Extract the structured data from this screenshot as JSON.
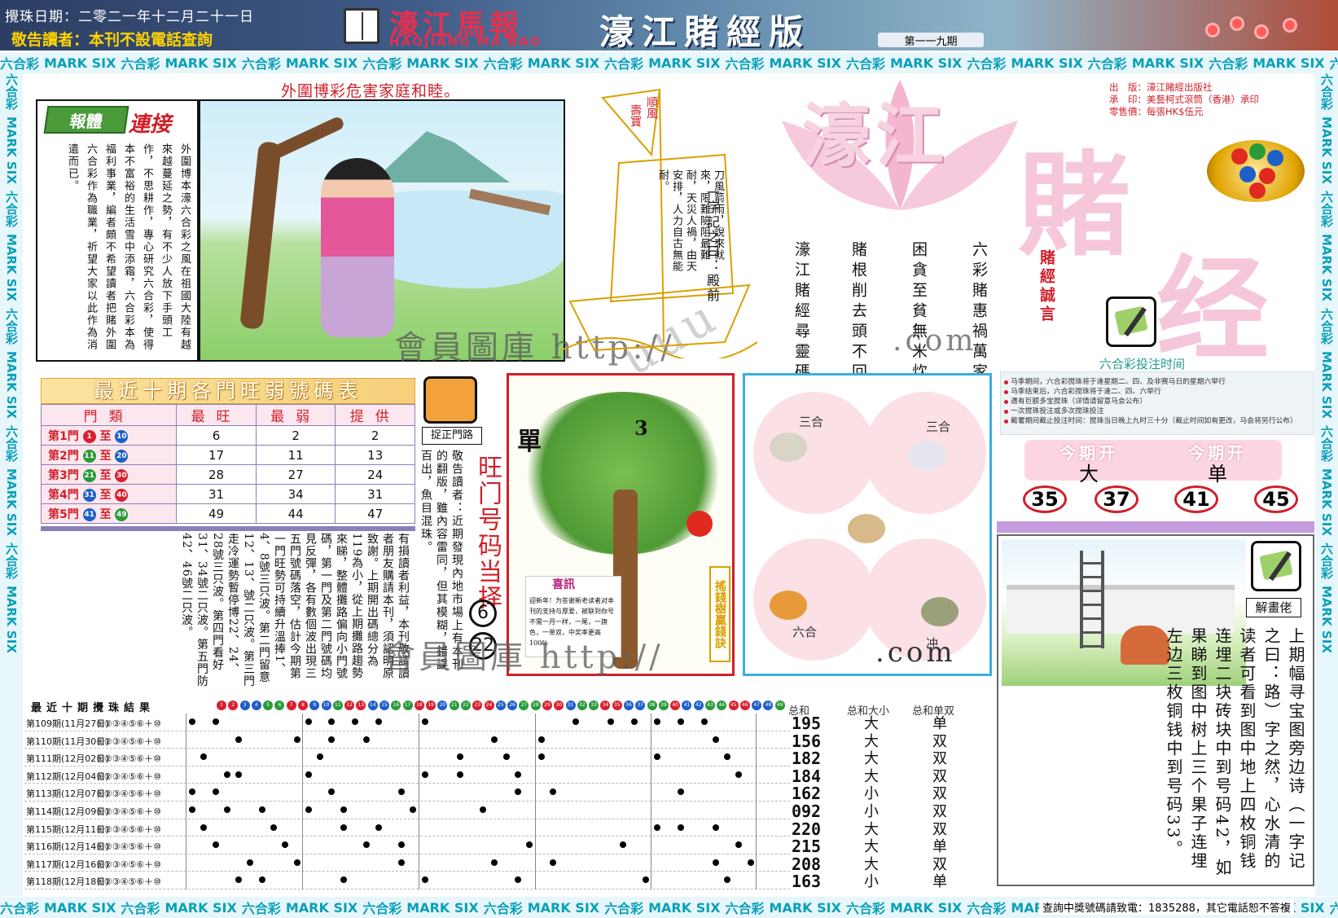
{
  "header": {
    "draw_date": "攪珠日期：二零二一年十二月二十一日",
    "warning": "敬告讀者：本刊不設電話查詢",
    "paper_name": "濠江馬報",
    "paper_name_en": "HAOJIANG MA BAO",
    "edition_title": "濠江賭經版",
    "issue": "第一一九期"
  },
  "band_text": [
    "六合彩",
    "MARK SIX"
  ],
  "slogan": "外圍博彩危害家庭和睦。",
  "article": {
    "badge": "報體",
    "badge_tail": "連接",
    "body": "外圍博本濠六合彩之風在祖國大陸有越來越蔓延之勢，有不少人放下手頭工作，不思耕作，專心研究六合彩，使得本不富裕的生活雪中添霜，六合彩本為福利事業，編者頗不希望讀者把賭外圍六合彩作為職業，祈望大家以此作為消遣而已。"
  },
  "watermarks": {
    "member": "會員圖庫 http://",
    "dotcom": ".com"
  },
  "ship": {
    "flag_line1": "順風",
    "flag_line2": "壽寶",
    "title": "一字記之曰：殿前",
    "poem": "刀風箭雨，說來就來，限難險阻最難耐，天災人禍，由天安排，人力自古無能耐。"
  },
  "big_title": {
    "haojiang": "濠江",
    "du": "賭",
    "jing": "经",
    "publisher": [
      "出　版：濠江賭經出版社",
      "承　印：美藝柯式滾筒（香港）承印",
      "零售價：每張HK$伍元"
    ],
    "motto": "賭經誠言",
    "columns": [
      "六彩賭惠禍萬家",
      "困貪至貧無米炊",
      "賭根削去頭不回",
      "濠江賭經尋靈碼"
    ]
  },
  "time_info": {
    "title": "六合彩投注时间",
    "items": [
      "马季期间，六合彩搅珠将于逢星期二、四、及非赛马日的星期六举行",
      "马季结束后，六合彩搅珠将于逢二、四、六举行",
      "遇有巨额多宝搅珠（详情请留意马会公布）",
      "一次搅珠投注或多次搅珠投注",
      "截署期间截止投注时间：搅珠当日晚上九时三十分（截止时间如有更改，马会将另行公布）"
    ],
    "open_label": "今期开",
    "open_values": [
      "大",
      "单"
    ],
    "numbers": [
      "35",
      "37",
      "41",
      "45"
    ]
  },
  "zone_table": {
    "title": "最近十期各門旺弱號碼表",
    "headers": [
      "門類",
      "最旺",
      "最弱",
      "提供"
    ],
    "rows": [
      {
        "gate": "第1門",
        "from": "1",
        "from_color": "r",
        "to": "10",
        "to_color": "b",
        "hot": "6",
        "cold": "2",
        "tip": "2"
      },
      {
        "gate": "第2門",
        "from": "11",
        "from_color": "g",
        "to": "20",
        "to_color": "b",
        "hot": "17",
        "cold": "11",
        "tip": "13"
      },
      {
        "gate": "第3門",
        "from": "21",
        "from_color": "g",
        "to": "30",
        "to_color": "r",
        "hot": "28",
        "cold": "27",
        "tip": "24"
      },
      {
        "gate": "第4門",
        "from": "31",
        "from_color": "b",
        "to": "40",
        "to_color": "r",
        "hot": "31",
        "cold": "34",
        "tip": "31"
      },
      {
        "gate": "第5門",
        "from": "41",
        "from_color": "b",
        "to": "49",
        "to_color": "g",
        "hot": "49",
        "cold": "44",
        "tip": "47"
      }
    ],
    "to_word": "至"
  },
  "catch_label": "捉正門路",
  "notice": "敬告讀者：近期發現內地市場上有本刊的翻版，雖內容雷同，但其模糊，錯誤百出，魚目混珠。",
  "hot_gate": {
    "title": "旺门号码当择",
    "numbers": [
      "6",
      "22"
    ]
  },
  "analysis": "有損讀者利益，本刊敬請讀者朋友購請本刊，須認明原致謝。上期開出碼總分為119為小，從上期攤路趨勢來睇，整體攤路偏向小門號碼，第一門及第二門號碼均見反彈，各有數個波出現三五門號碼落空，估計今期第一門旺勢可持續升溫捧1、4、8號三只波。第二門留意12、13、號二只波。第三門走冷運勢暫停博22、24、28號三只波。第四門看好31、34號二只波。第五門防42、46號二只波。",
  "tree": {
    "single": "單",
    "three": "3",
    "news_title": "喜訊",
    "news_body": "迎新年！为答谢新老读者对本刊的支持与厚爱，被联到你号不需一月一样，一尾，一旗色，一单双，中奖率更高100%",
    "side": "搖錢樹贏錢訣"
  },
  "zodiac": {
    "labels": [
      "三合",
      "三合",
      "六合",
      "冲"
    ],
    "dotcom": ".com"
  },
  "results": {
    "title": "最近十期攪珠結果",
    "number_balls": [
      "1",
      "2",
      "3",
      "4",
      "5",
      "6",
      "7",
      "8",
      "9",
      "10",
      "11",
      "12",
      "13",
      "14",
      "15",
      "16",
      "17",
      "18",
      "19",
      "20",
      "21",
      "22",
      "23",
      "24",
      "25",
      "26",
      "27",
      "28",
      "29",
      "30",
      "31",
      "32",
      "33",
      "34",
      "35",
      "36",
      "37",
      "38",
      "39",
      "40",
      "41",
      "42",
      "43",
      "44",
      "45",
      "46",
      "47",
      "48",
      "49"
    ],
    "stat_headers": [
      "总和",
      "总和大小",
      "总和单双"
    ],
    "rows": [
      {
        "period": "第109期",
        "date": "(11月27日)",
        "circles": "①②③④⑤⑥＋⑩",
        "sum": "195",
        "size": "大",
        "parity": "单",
        "marks": [
          1,
          3,
          11,
          13,
          15,
          17,
          21,
          34,
          37,
          39,
          41,
          43,
          45
        ]
      },
      {
        "period": "第110期",
        "date": "(11月30日)",
        "circles": "①②③④⑤⑥＋⑩",
        "sum": "156",
        "size": "大",
        "parity": "双",
        "marks": [
          5,
          10,
          13,
          16,
          27,
          31,
          46
        ]
      },
      {
        "period": "第111期",
        "date": "(12月02日)",
        "circles": "①②③④⑤⑥＋⑩",
        "sum": "182",
        "size": "大",
        "parity": "双",
        "marks": [
          2,
          12,
          24,
          28,
          31,
          41,
          47
        ]
      },
      {
        "period": "第112期",
        "date": "(12月04日)",
        "circles": "①②③④⑤⑥＋⑩",
        "sum": "184",
        "size": "大",
        "parity": "双",
        "marks": [
          4,
          5,
          11,
          21,
          24,
          29,
          48
        ]
      },
      {
        "period": "第113期",
        "date": "(12月07日)",
        "circles": "①②③④⑤⑥＋⑩",
        "sum": "162",
        "size": "小",
        "parity": "双",
        "marks": [
          1,
          3,
          13,
          19,
          29,
          32,
          43
        ]
      },
      {
        "period": "第114期",
        "date": "(12月09日)",
        "circles": "①②③④⑤⑥＋⑩",
        "sum": "092",
        "size": "小",
        "parity": "双",
        "marks": [
          1,
          4,
          7,
          11,
          14,
          20,
          26
        ]
      },
      {
        "period": "第115期",
        "date": "(12月11日)",
        "circles": "①②③④⑤⑥＋⑩",
        "sum": "220",
        "size": "大",
        "parity": "双",
        "marks": [
          2,
          8,
          14,
          17,
          41,
          43,
          46
        ]
      },
      {
        "period": "第116期",
        "date": "(12月14日)",
        "circles": "①②③④⑤⑥＋⑩",
        "sum": "215",
        "size": "大",
        "parity": "单",
        "marks": [
          3,
          9,
          16,
          19,
          30,
          38,
          48
        ]
      },
      {
        "period": "第117期",
        "date": "(12月16日)",
        "circles": "①②③④⑤⑥＋⑩",
        "sum": "208",
        "size": "大",
        "parity": "双",
        "marks": [
          6,
          10,
          19,
          27,
          32,
          46,
          49
        ]
      },
      {
        "period": "第118期",
        "date": "(12月18日)",
        "circles": "①②③④⑤⑥＋⑩",
        "sum": "163",
        "size": "小",
        "parity": "单",
        "marks": [
          5,
          7,
          14,
          21,
          29,
          40,
          47
        ]
      }
    ]
  },
  "riddle": {
    "label": "解畫佬",
    "body": "上期幅寻宝图旁边诗（一字记之曰：路）字之然，心水清的读者可看到图中地上四枚铜钱连埋二块砖块中到号码42，如果睇到图中树上三个果子连埋左边三枚铜钱中到号码33。"
  },
  "footer_note": "查詢中獎號碼請致電：1835288，其它電話恕不答複",
  "colors": {
    "red": "#d0202a",
    "teal": "#0aa0b8",
    "pink": "#f6c7db",
    "blue": "#3aaede",
    "purple": "#8b7fb8"
  }
}
